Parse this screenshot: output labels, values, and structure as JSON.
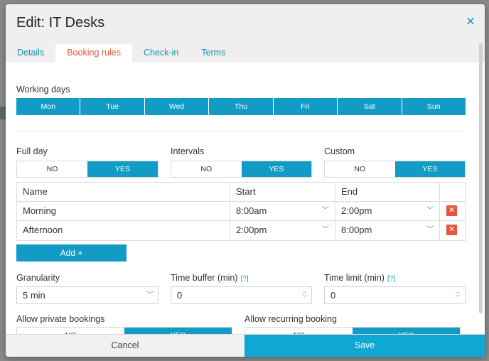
{
  "modal": {
    "title": "Edit: IT Desks",
    "close_icon": "×"
  },
  "tabs": [
    {
      "label": "Details",
      "active": false
    },
    {
      "label": "Booking rules",
      "active": true
    },
    {
      "label": "Check-in",
      "active": false
    },
    {
      "label": "Terms",
      "active": false
    }
  ],
  "working_days": {
    "label": "Working days",
    "days": [
      "Mon",
      "Tue",
      "Wed",
      "Thu",
      "Fri",
      "Sat",
      "Sun"
    ]
  },
  "full_day": {
    "label": "Full day",
    "no": "NO",
    "yes": "YES",
    "selected": "YES"
  },
  "intervals": {
    "label": "Intervals",
    "no": "NO",
    "yes": "YES",
    "selected": "YES"
  },
  "custom": {
    "label": "Custom",
    "no": "NO",
    "yes": "YES",
    "selected": "YES"
  },
  "interval_table": {
    "headers": [
      "Name",
      "Start",
      "End"
    ],
    "rows": [
      {
        "name": "Morning",
        "start": "8:00am",
        "end": "2:00pm"
      },
      {
        "name": "Afternoon",
        "start": "2:00pm",
        "end": "8:00pm"
      }
    ]
  },
  "add_button": "Add +",
  "granularity": {
    "label": "Granularity",
    "value": "5 min"
  },
  "time_buffer": {
    "label": "Time buffer (min)",
    "help": "[?]",
    "value": "0"
  },
  "time_limit": {
    "label": "Time limit (min)",
    "help": "[?]",
    "value": "0"
  },
  "private_bookings": {
    "label": "Allow private bookings",
    "no": "NO",
    "yes": "YES",
    "selected": "YES"
  },
  "recurring_booking": {
    "label": "Allow recurring booking",
    "no": "NO",
    "yes": "YES",
    "selected": "YES"
  },
  "footer": {
    "cancel": "Cancel",
    "save": "Save"
  },
  "colors": {
    "accent": "#129cc5",
    "active_tab": "#e8563a",
    "delete": "#e8523f"
  }
}
